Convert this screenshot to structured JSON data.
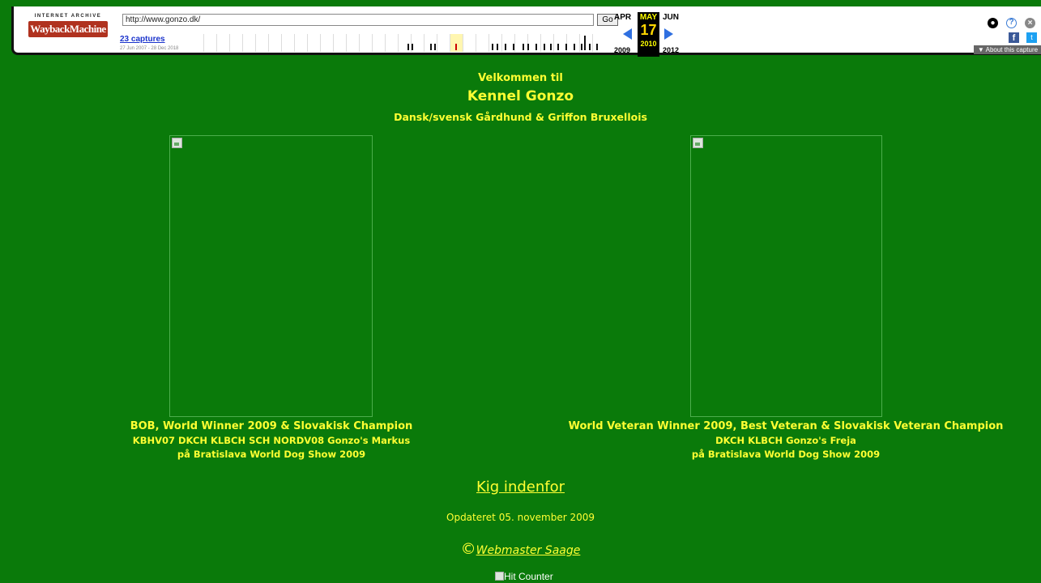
{
  "wayback": {
    "logo_top": "INTERNET ARCHIVE",
    "logo_main": "WaybackMachine",
    "url": "http://www.gonzo.dk/",
    "go_label": "Go",
    "captures": "23 captures",
    "capture_range": "27 Jun 2007 - 28 Dec 2018",
    "prev_month": "APR",
    "cur_month": "MAY",
    "next_month": "JUN",
    "cur_day": "17",
    "prev_year": "2009",
    "cur_year": "2010",
    "next_year": "2012",
    "about_label": "▼ About this capture",
    "icons": [
      "user-icon",
      "help-icon",
      "close-icon",
      "facebook-icon",
      "twitter-icon"
    ]
  },
  "page": {
    "welcome": "Velkommen til",
    "kennel": "Kennel Gonzo",
    "breeds": "Dansk/svensk Gårdhund & Griffon Bruxellois",
    "left_caption": {
      "line1": "BOB, World Winner 2009 & Slovakisk Champion",
      "line2": "KBHV07 DKCH KLBCH SCH NORDV08 Gonzo's Markus",
      "line3": "på Bratislava World Dog Show 2009"
    },
    "right_caption": {
      "line1": "World Veteran Winner 2009, Best Veteran &  Slovakisk Veteran Champion",
      "line2": "DKCH KLBCH Gonzo's Freja",
      "line3": "på Bratislava World Dog Show 2009"
    },
    "enter_link": "Kig indenfor",
    "updated": "Opdateret 05. november 2009",
    "copyright_symbol": "©",
    "webmaster": "Webmaster Saage",
    "hit_counter_alt": "Hit Counter"
  },
  "colors": {
    "background": "#0a7a0a",
    "text": "#ffff33"
  }
}
